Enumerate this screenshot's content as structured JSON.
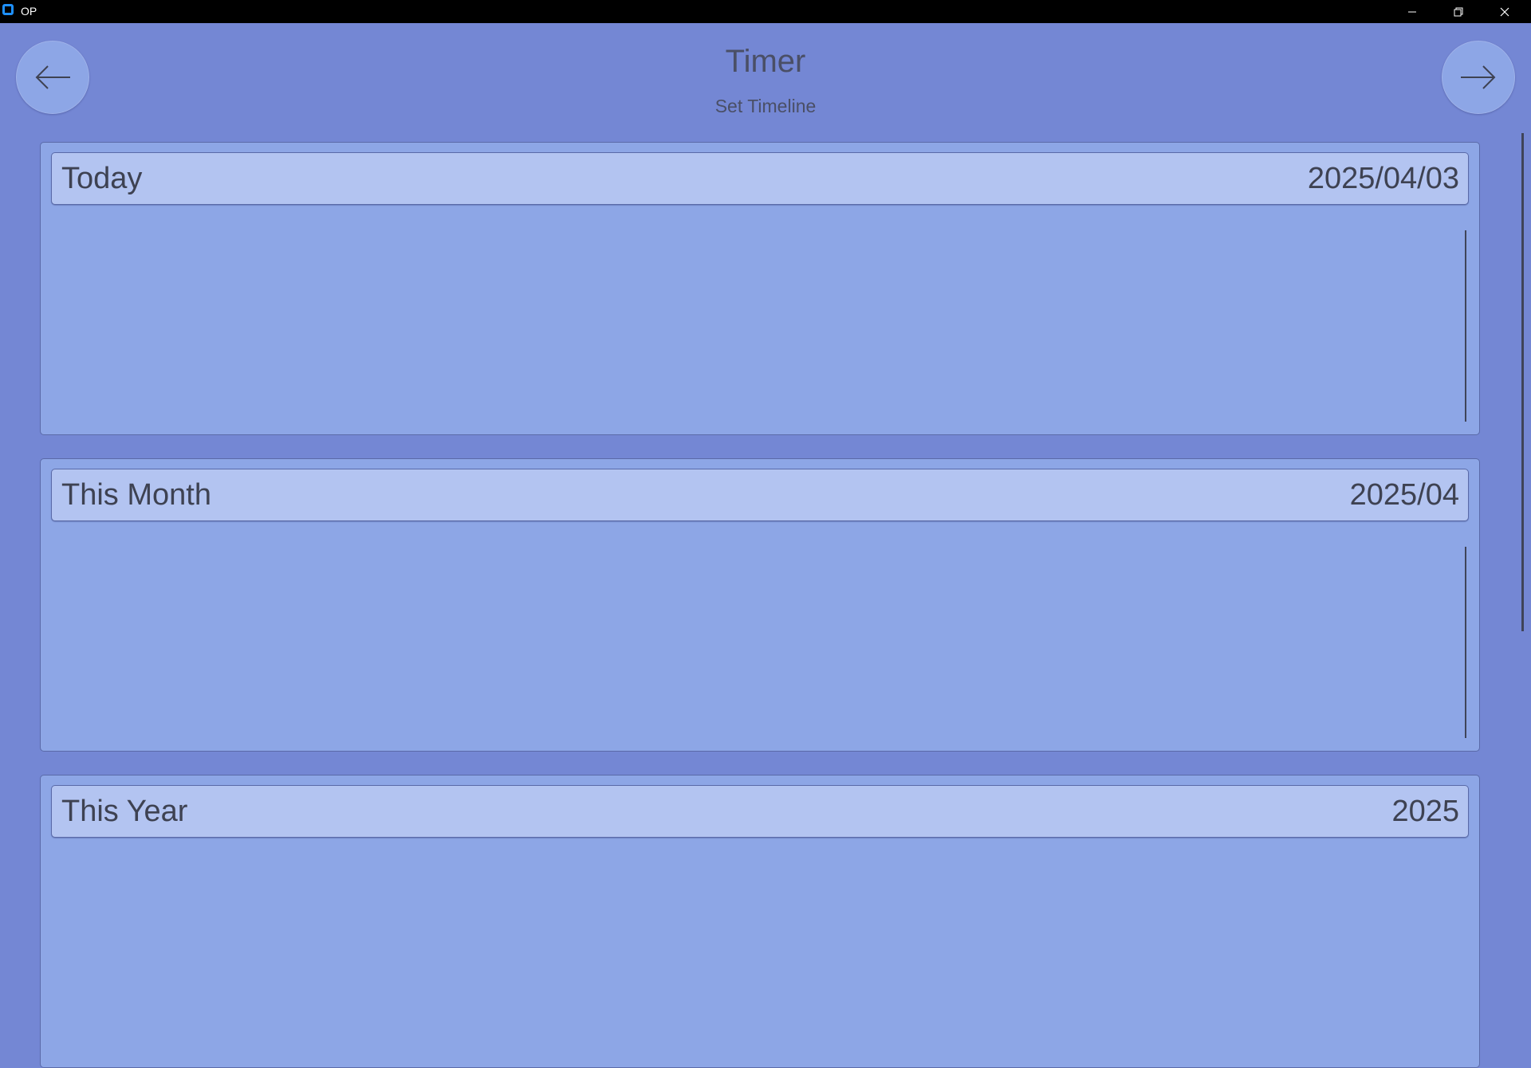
{
  "window": {
    "title": "OP"
  },
  "header": {
    "title": "Timer",
    "subtitle": "Set Timeline"
  },
  "cards": [
    {
      "label": "Today",
      "date": "2025/04/03"
    },
    {
      "label": "This Month",
      "date": "2025/04"
    },
    {
      "label": "This Year",
      "date": "2025"
    }
  ],
  "colors": {
    "background": "#7487d4",
    "card": "#8da6e6",
    "card_header": "#b3c4f1",
    "titlebar": "#000000",
    "text": "#3e4252"
  },
  "icons": {
    "back": "arrow-left-icon",
    "forward": "arrow-right-icon",
    "minimize": "minimize-icon",
    "restore": "restore-icon",
    "close": "close-icon"
  }
}
